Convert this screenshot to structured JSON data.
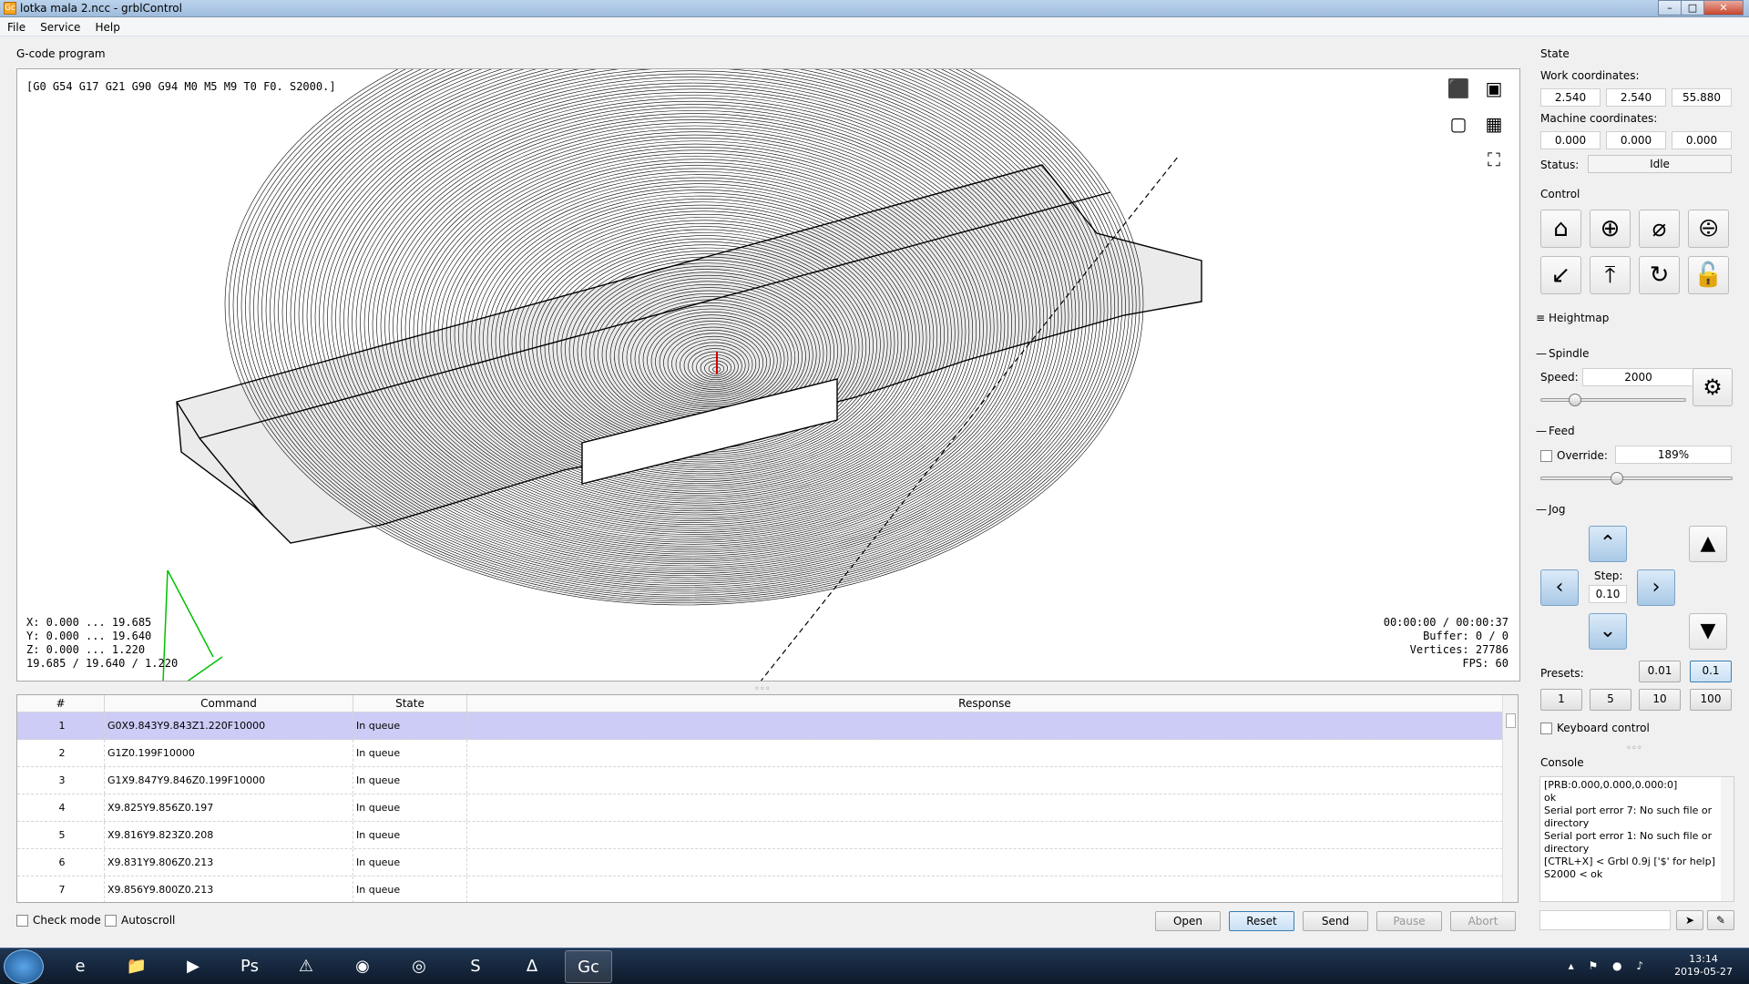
{
  "window": {
    "title": "lotka mala 2.ncc - grblControl",
    "app_icon": "Gc",
    "buttons": [
      "–",
      "□",
      "✕"
    ]
  },
  "menu": [
    "File",
    "Service",
    "Help"
  ],
  "gcode_program": {
    "label": "G-code program",
    "parser_state": "[G0 G54 G17 G21 G90 G94 M0 M5 M9 T0 F0. S2000.]",
    "ranges": [
      "X: 0.000 ... 19.685",
      "Y: 0.000 ... 19.640",
      "Z: 0.000 ... 1.220",
      "19.685 / 19.640 / 1.220"
    ],
    "stats": [
      "00:00:00 / 00:00:37",
      "Buffer: 0 / 0",
      "Vertices: 27786",
      "FPS: 60"
    ]
  },
  "splitter_grip": "◦◦◦",
  "table": {
    "headers": [
      "#",
      "Command",
      "State",
      "Response"
    ],
    "rows": [
      {
        "n": "1",
        "cmd": "G0X9.843Y9.843Z1.220F10000",
        "state": "In queue",
        "resp": ""
      },
      {
        "n": "2",
        "cmd": "G1Z0.199F10000",
        "state": "In queue",
        "resp": ""
      },
      {
        "n": "3",
        "cmd": "G1X9.847Y9.846Z0.199F10000",
        "state": "In queue",
        "resp": ""
      },
      {
        "n": "4",
        "cmd": "X9.825Y9.856Z0.197",
        "state": "In queue",
        "resp": ""
      },
      {
        "n": "5",
        "cmd": "X9.816Y9.823Z0.208",
        "state": "In queue",
        "resp": ""
      },
      {
        "n": "6",
        "cmd": "X9.831Y9.806Z0.213",
        "state": "In queue",
        "resp": ""
      },
      {
        "n": "7",
        "cmd": "X9.856Y9.800Z0.213",
        "state": "In queue",
        "resp": ""
      }
    ]
  },
  "bottom": {
    "check_mode": "Check mode",
    "autoscroll": "Autoscroll",
    "buttons": {
      "open": "Open",
      "reset": "Reset",
      "send": "Send",
      "pause": "Pause",
      "abort": "Abort"
    }
  },
  "state": {
    "label": "State",
    "work_label": "Work coordinates:",
    "work": [
      "2.540",
      "2.540",
      "55.880"
    ],
    "machine_label": "Machine coordinates:",
    "machine": [
      "0.000",
      "0.000",
      "0.000"
    ],
    "status_label": "Status:",
    "status": "Idle"
  },
  "control": {
    "label": "Control",
    "icons": [
      "home-icon",
      "zero-probe-icon",
      "zero-xy-icon",
      "zero-z-icon",
      "restore-origin-icon",
      "safe-position-icon",
      "reset-icon",
      "unlock-icon"
    ]
  },
  "heightmap": {
    "label": "Heightmap"
  },
  "spindle": {
    "label": "Spindle",
    "speed_label": "Speed:",
    "speed": "2000",
    "slider_fraction": 0.24
  },
  "feed": {
    "label": "Feed",
    "override_label": "Override:",
    "override": "189%",
    "slider_fraction": 0.4
  },
  "jog": {
    "label": "Jog",
    "step_label": "Step:",
    "step": "0.10",
    "presets_label": "Presets:",
    "presets_top": [
      "0.01",
      "0.1"
    ],
    "presets_bottom": [
      "1",
      "5",
      "10",
      "100"
    ],
    "keyboard_control": "Keyboard control"
  },
  "console": {
    "label": "Console",
    "lines": [
      "[PRB:0.000,0.000,0.000:0]",
      "ok",
      "Serial port error 7: No such file or directory",
      "Serial port error 1: No such file or directory",
      "[CTRL+X] < Grbl 0.9j ['$' for help]",
      "S2000 < ok"
    ]
  },
  "clock": {
    "time": "13:14",
    "date": "2019-05-27"
  },
  "colors": {
    "selected_row": "#ccccf6",
    "taskbar": "#15263b",
    "toolpath": "#000000",
    "axis_green": "#00c000",
    "tool_red": "#d00000"
  }
}
